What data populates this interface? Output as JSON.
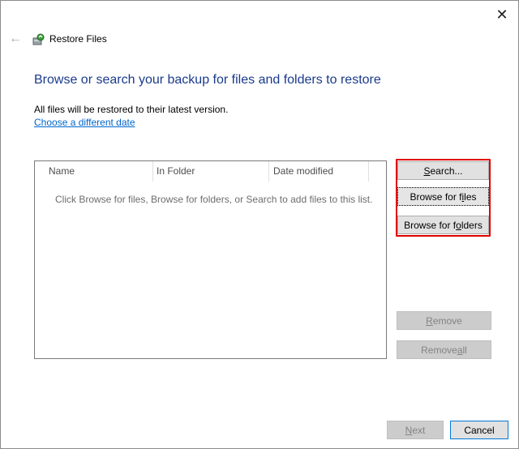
{
  "window": {
    "title": "Restore Files",
    "close_glyph": "✕",
    "back_glyph": "←"
  },
  "main": {
    "heading": "Browse or search your backup for files and folders to restore",
    "info": "All files will be restored to their latest version.",
    "link": "Choose a different date"
  },
  "list": {
    "columns": [
      "Name",
      "In Folder",
      "Date modified"
    ],
    "empty_message": "Click Browse for files, Browse for folders, or Search to add files to this list."
  },
  "buttons": {
    "search": {
      "pre": "",
      "key": "S",
      "post": "earch..."
    },
    "browse_files": {
      "pre": "Browse for f",
      "key": "i",
      "post": "les"
    },
    "browse_folders": {
      "pre": "Browse for f",
      "key": "o",
      "post": "lders"
    },
    "remove": {
      "pre": "",
      "key": "R",
      "post": "emove"
    },
    "remove_all": {
      "pre": "Remove ",
      "key": "a",
      "post": "ll"
    },
    "next": {
      "pre": "",
      "key": "N",
      "post": "ext"
    },
    "cancel": "Cancel"
  },
  "colors": {
    "heading": "#1a3a8c",
    "link": "#0066cc",
    "highlight": "#e00000"
  },
  "icons": {
    "app": "restore-files-icon",
    "close": "close-icon",
    "back": "back-arrow-icon"
  }
}
